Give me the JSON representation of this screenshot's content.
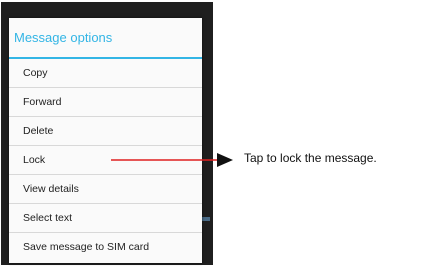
{
  "dialog": {
    "title": "Message options",
    "items": [
      {
        "label": "Copy"
      },
      {
        "label": "Forward"
      },
      {
        "label": "Delete"
      },
      {
        "label": "Lock"
      },
      {
        "label": "View details"
      },
      {
        "label": "Select text"
      },
      {
        "label": "Save message to SIM card"
      }
    ]
  },
  "annotation": {
    "text": "Tap to lock the message."
  },
  "colors": {
    "accent": "#33b5e5",
    "pointer": "#e02020",
    "dialog_bg": "#fafafa",
    "scrim": "#1f1f1f"
  }
}
